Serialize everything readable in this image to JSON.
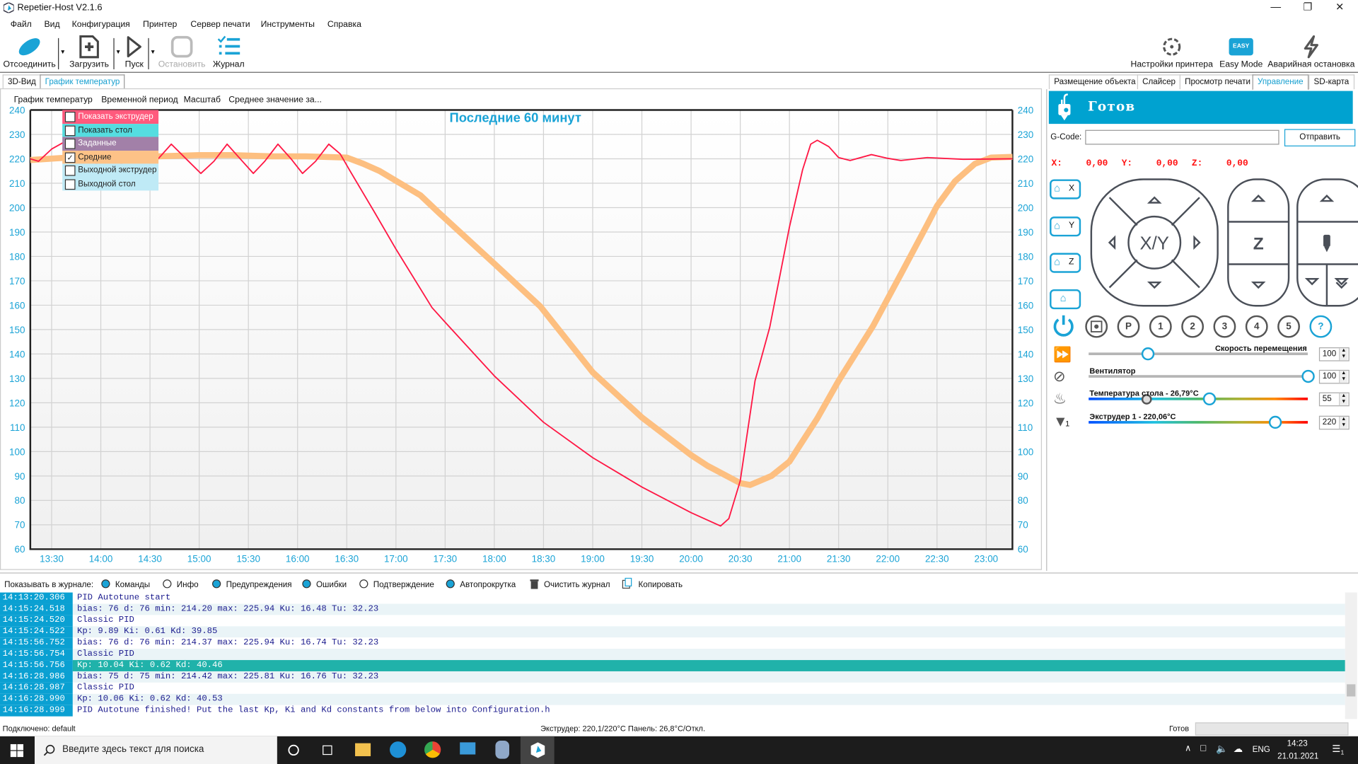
{
  "window": {
    "title": "Repetier-Host V2.1.6",
    "controls": [
      "minimize",
      "restore",
      "close"
    ]
  },
  "menu": [
    "Файл",
    "Вид",
    "Конфигурация",
    "Принтер",
    "Сервер печати",
    "Инструменты",
    "Справка"
  ],
  "toolbar": {
    "disconnect": "Отсоединить",
    "load": "Загрузить",
    "run": "Пуск",
    "stop": "Остановить",
    "log": "Журнал",
    "printer_settings": "Настройки принтера",
    "easy_mode": "Easy Mode",
    "easy_badge": "EASY",
    "emergency": "Аварийная остановка"
  },
  "left_tabs": [
    {
      "label": "3D-Вид",
      "active": false
    },
    {
      "label": "График температур",
      "active": true
    }
  ],
  "chart_menu": [
    "График температур",
    "Временной период",
    "Масштаб",
    "Среднее значение за..."
  ],
  "legend": [
    {
      "label": "Показать экструдер",
      "checked": true,
      "color": "#ff5a7d"
    },
    {
      "label": "Показать стол",
      "checked": false,
      "color": "#55dde0"
    },
    {
      "label": "Заданные",
      "checked": false,
      "color": "#a280a8"
    },
    {
      "label": "Средние",
      "checked": true,
      "color": "#fdc287"
    },
    {
      "label": "Выходной экструдер",
      "checked": false,
      "color": "#bfeaf6"
    },
    {
      "label": "Выходной стол",
      "checked": false,
      "color": "#bfeaf6"
    }
  ],
  "chart_data": {
    "type": "line",
    "title": "Последние 60 минут",
    "xlim": [
      "13:17",
      "23:16"
    ],
    "ylim": [
      60,
      240
    ],
    "yticks": [
      60,
      70,
      80,
      90,
      100,
      110,
      120,
      130,
      140,
      150,
      160,
      170,
      180,
      190,
      200,
      210,
      220,
      230,
      240
    ],
    "xticks": [
      "13:30",
      "14:00",
      "14:30",
      "15:00",
      "15:30",
      "16:00",
      "16:30",
      "17:00",
      "17:30",
      "18:00",
      "18:30",
      "19:00",
      "19:30",
      "20:00",
      "20:30",
      "21:00",
      "21:30",
      "22:00",
      "22:30",
      "23:00"
    ],
    "grid": true,
    "series": [
      {
        "color": "#ff1744",
        "points": [
          [
            "13:17",
            220
          ],
          [
            "13:22",
            219
          ],
          [
            "13:30",
            224
          ],
          [
            "13:38",
            227
          ],
          [
            "13:50",
            222
          ],
          [
            "14:05",
            214
          ],
          [
            "14:20",
            222
          ],
          [
            "14:35",
            220
          ],
          [
            "14:43",
            226
          ],
          [
            "14:52",
            220
          ],
          [
            "15:01",
            214
          ],
          [
            "15:09",
            219
          ],
          [
            "15:17",
            226
          ],
          [
            "15:25",
            220
          ],
          [
            "15:33",
            214
          ],
          [
            "15:40",
            219
          ],
          [
            "15:48",
            226
          ],
          [
            "15:56",
            220
          ],
          [
            "16:03",
            214
          ],
          [
            "16:11",
            219
          ],
          [
            "16:19",
            226
          ],
          [
            "16:26",
            222
          ],
          [
            "16:32",
            215
          ],
          [
            "16:47",
            198
          ],
          [
            "17:00",
            183
          ],
          [
            "17:22",
            159
          ],
          [
            "17:30",
            153
          ],
          [
            "18:00",
            131
          ],
          [
            "18:30",
            112
          ],
          [
            "19:00",
            97.5
          ],
          [
            "19:30",
            85.5
          ],
          [
            "20:00",
            75
          ],
          [
            "20:18",
            69.5
          ],
          [
            "20:23",
            72.5
          ],
          [
            "20:30",
            88
          ],
          [
            "20:39",
            129
          ],
          [
            "20:48",
            151
          ],
          [
            "21:00",
            192
          ],
          [
            "21:08",
            215.5
          ],
          [
            "21:13",
            226
          ],
          [
            "21:17",
            227.6
          ],
          [
            "21:24",
            225
          ],
          [
            "21:30",
            220.5
          ],
          [
            "21:37",
            219.3
          ],
          [
            "21:50",
            221.7
          ],
          [
            "22:00",
            220.2
          ],
          [
            "22:08",
            219.3
          ],
          [
            "22:24",
            220.5
          ],
          [
            "22:46",
            219.8
          ],
          [
            "23:16",
            220
          ]
        ]
      },
      {
        "color": "#fdbf80",
        "points": [
          [
            "13:17",
            219.5
          ],
          [
            "13:40",
            220.5
          ],
          [
            "14:10",
            221
          ],
          [
            "14:35",
            221
          ],
          [
            "15:00",
            221.5
          ],
          [
            "15:20",
            221.5
          ],
          [
            "15:45",
            221
          ],
          [
            "16:05",
            221
          ],
          [
            "16:30",
            220.5
          ],
          [
            "16:40",
            218
          ],
          [
            "16:50",
            215
          ],
          [
            "17:00",
            211
          ],
          [
            "17:15",
            205
          ],
          [
            "17:26",
            198
          ],
          [
            "18:00",
            177
          ],
          [
            "18:28",
            159.5
          ],
          [
            "19:00",
            132.5
          ],
          [
            "19:30",
            114
          ],
          [
            "20:00",
            98.6
          ],
          [
            "20:10",
            94.2
          ],
          [
            "20:30",
            87.1
          ],
          [
            "20:36",
            86.3
          ],
          [
            "20:49",
            90
          ],
          [
            "21:00",
            95.9
          ],
          [
            "21:17",
            113.6
          ],
          [
            "21:30",
            129
          ],
          [
            "21:51",
            151.5
          ],
          [
            "22:08",
            172.8
          ],
          [
            "22:24",
            193
          ],
          [
            "22:30",
            200.7
          ],
          [
            "22:41",
            210.8
          ],
          [
            "22:53",
            217.9
          ],
          [
            "23:03",
            220.5
          ],
          [
            "23:16",
            220.8
          ]
        ]
      }
    ]
  },
  "right_tabs": [
    {
      "label": "Размещение объекта",
      "active": false
    },
    {
      "label": "Слайсер",
      "active": false
    },
    {
      "label": "Просмотр печати",
      "active": false
    },
    {
      "label": "Управление",
      "active": true
    },
    {
      "label": "SD-карта",
      "active": false
    }
  ],
  "control": {
    "status": "Готов",
    "gcode_label": "G-Code:",
    "gcode_value": "",
    "send": "Отправить",
    "pos": {
      "x_label": "X:",
      "x": "0,00",
      "y_label": "Y:",
      "y": "0,00",
      "z_label": "Z:",
      "z": "0,00"
    },
    "home": [
      "X",
      "Y",
      "Z",
      ""
    ],
    "xy_label": "X/Y",
    "z_label": "Z",
    "quick": [
      "P",
      "1",
      "2",
      "3",
      "4",
      "5",
      "?"
    ],
    "speed": {
      "label": "Скорость перемещения",
      "value": "100",
      "level": 0.27
    },
    "fan": {
      "label": "Вентилятор",
      "value": "100",
      "level": 1.0
    },
    "bed": {
      "label": "Температура стола - 26,79°C",
      "value": "55",
      "level": 0.55,
      "current_level": 0.26
    },
    "extruder": {
      "label": "Экструдер 1 - 220,06°C",
      "value": "220",
      "level": 0.85,
      "index": "1"
    }
  },
  "log": {
    "filter_label": "Показывать в журнале:",
    "filters": [
      {
        "label": "Команды",
        "on": true
      },
      {
        "label": "Инфо",
        "on": false
      },
      {
        "label": "Предупреждения",
        "on": true
      },
      {
        "label": "Ошибки",
        "on": true
      },
      {
        "label": "Подтверждение",
        "on": false
      },
      {
        "label": "Автопрокрутка",
        "on": true
      }
    ],
    "clear": "Очистить журнал",
    "copy": "Копировать",
    "rows": [
      {
        "ts": "14:13:20.306",
        "msg": "PID Autotune start"
      },
      {
        "ts": "14:15:24.518",
        "msg": "bias: 76 d: 76 min: 214.20 max: 225.94 Ku: 16.48 Tu: 32.23"
      },
      {
        "ts": "14:15:24.520",
        "msg": "Classic PID"
      },
      {
        "ts": "14:15:24.522",
        "msg": "Kp: 9.89 Ki: 0.61 Kd: 39.85"
      },
      {
        "ts": "14:15:56.752",
        "msg": "bias: 76 d: 76 min: 214.37 max: 225.94 Ku: 16.74 Tu: 32.23"
      },
      {
        "ts": "14:15:56.754",
        "msg": "Classic PID"
      },
      {
        "ts": "14:15:56.756",
        "msg": "Kp: 10.04 Ki: 0.62 Kd: 40.46",
        "selected": true
      },
      {
        "ts": "14:16:28.986",
        "msg": "bias: 75 d: 75 min: 214.42 max: 225.81 Ku: 16.76 Tu: 32.23"
      },
      {
        "ts": "14:16:28.987",
        "msg": "Classic PID"
      },
      {
        "ts": "14:16:28.990",
        "msg": "Kp: 10.06 Ki: 0.62 Kd: 40.53"
      },
      {
        "ts": "14:16:28.999",
        "msg": "PID Autotune finished! Put the last Kp, Ki and Kd constants from below into Configuration.h"
      }
    ]
  },
  "statusbar": {
    "connection": "Подключено: default",
    "temps": "Экструдер: 220,1/220°C Панель: 26,8°C/Откл.",
    "state": "Готов"
  },
  "taskbar": {
    "search_placeholder": "Введите здесь текст для поиска",
    "lang": "ENG",
    "time": "14:23",
    "date": "21.01.2021",
    "notifications": "1"
  },
  "colors": {
    "accent": "#00a2d0",
    "extruder": "#ff1744",
    "average": "#fdbf80",
    "selected_row": "#20b2aa"
  }
}
